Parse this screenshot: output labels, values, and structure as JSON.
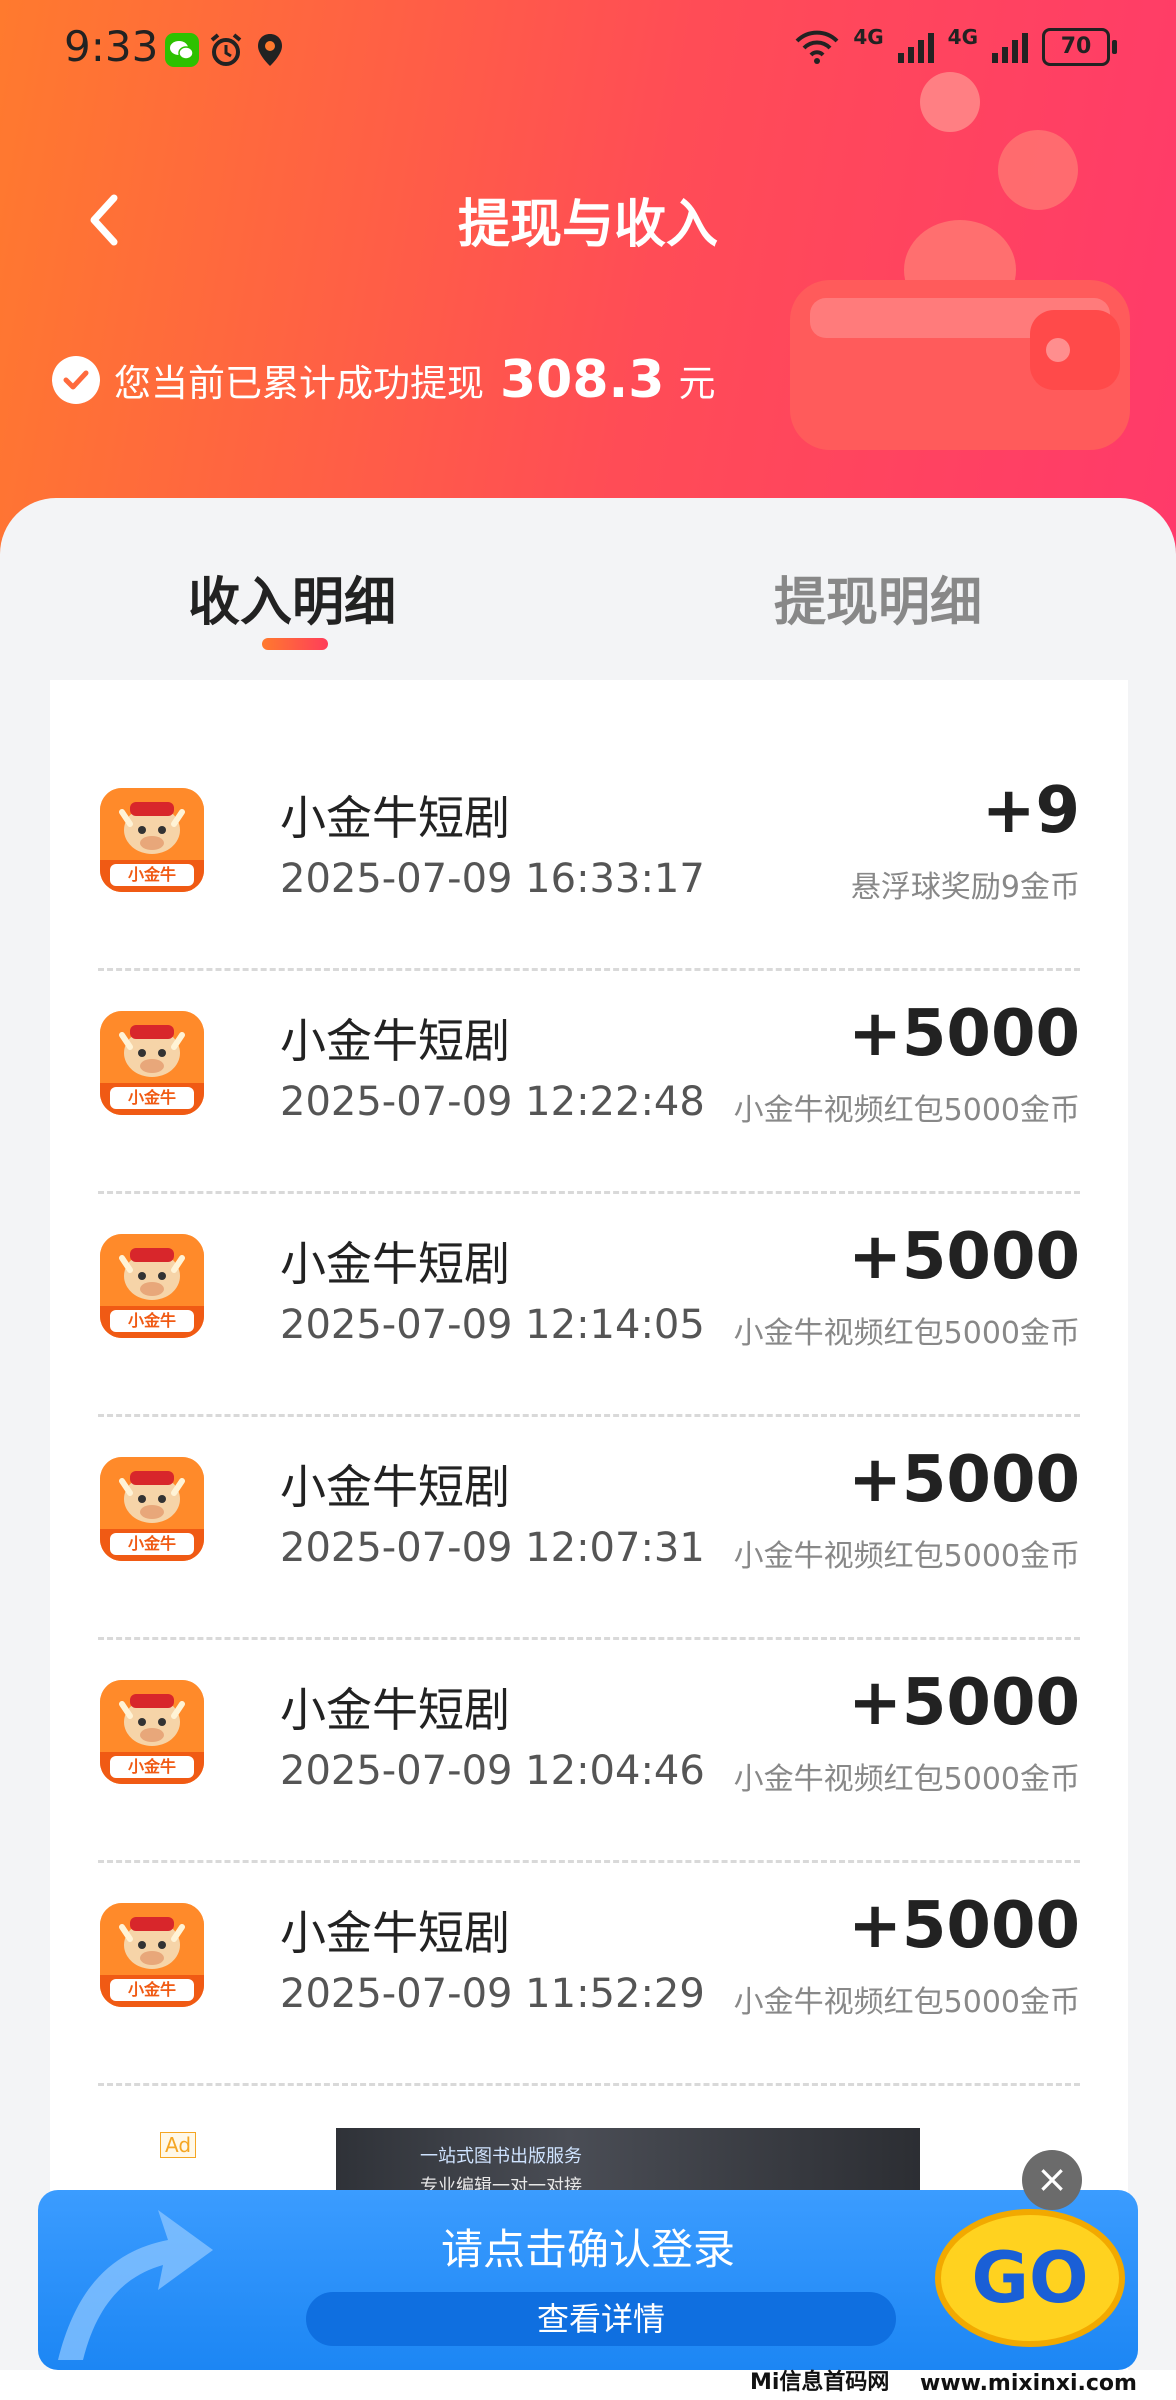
{
  "status_bar": {
    "time": "9:33",
    "network1": "4G",
    "network2": "4G",
    "battery": "70"
  },
  "header": {
    "title": "提现与收入",
    "summary_label": "您当前已累计成功提现",
    "summary_amount": "308.3",
    "summary_unit": "元"
  },
  "tabs": [
    {
      "label": "收入明细",
      "active": true
    },
    {
      "label": "提现明细",
      "active": false
    }
  ],
  "records": [
    {
      "name": "小金牛短剧",
      "time": "2025-07-09 16:33:17",
      "amount": "+9",
      "desc": "悬浮球奖励9金币"
    },
    {
      "name": "小金牛短剧",
      "time": "2025-07-09 12:22:48",
      "amount": "+5000",
      "desc": "小金牛视频红包5000金币"
    },
    {
      "name": "小金牛短剧",
      "time": "2025-07-09 12:14:05",
      "amount": "+5000",
      "desc": "小金牛视频红包5000金币"
    },
    {
      "name": "小金牛短剧",
      "time": "2025-07-09 12:07:31",
      "amount": "+5000",
      "desc": "小金牛视频红包5000金币"
    },
    {
      "name": "小金牛短剧",
      "time": "2025-07-09 12:04:46",
      "amount": "+5000",
      "desc": "小金牛视频红包5000金币"
    },
    {
      "name": "小金牛短剧",
      "time": "2025-07-09 11:52:29",
      "amount": "+5000",
      "desc": "小金牛视频红包5000金币"
    }
  ],
  "app_icon_label": "小金牛",
  "ad": {
    "badge": "Ad",
    "thumb_line1": "一站式图书出版服务",
    "thumb_line2": "专业编辑一对一对接",
    "banner_title": "请点击确认登录",
    "banner_button": "查看详情",
    "go_label": "GO",
    "close_icon": "×"
  },
  "watermark": {
    "left": "Mi信息首码网",
    "right": "www.mixinxi.com"
  },
  "colors": {
    "header_start": "#ff7a2e",
    "header_end": "#ff3a6a",
    "accent_underline": "#ff4d4f",
    "banner_blue": "#1c86f4"
  }
}
